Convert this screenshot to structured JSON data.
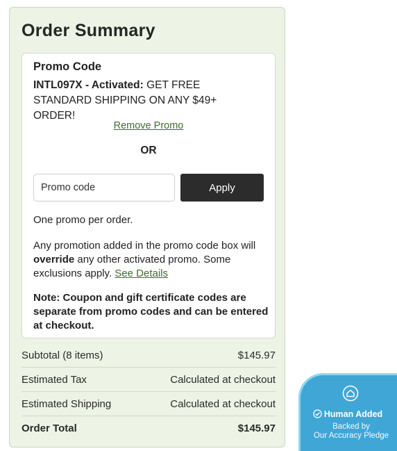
{
  "order_summary": {
    "title": "Order Summary",
    "promo": {
      "heading": "Promo Code",
      "activated_code": "INTL097X - Activated:",
      "activated_message": "GET FREE STANDARD SHIPPING ON ANY $49+ ORDER!",
      "remove_label": "Remove Promo",
      "or_label": "OR",
      "input_value": "",
      "input_placeholder": "Promo code",
      "apply_label": "Apply",
      "one_per_order": "One promo per order.",
      "override_text_1": "Any promotion added in the promo code box will",
      "override_bold": "override",
      "override_text_2": "any other activated promo. Some exclusions apply.",
      "see_details_label": "See Details",
      "coupon_note": "Note: Coupon and gift certificate codes are separate from promo codes and can be entered at checkout."
    },
    "rows": [
      {
        "label": "Subtotal (8 items)",
        "value": "$145.97"
      },
      {
        "label": "Estimated Tax",
        "value": "Calculated at checkout"
      },
      {
        "label": "Estimated Shipping",
        "value": "Calculated at checkout"
      },
      {
        "label": "Order Total",
        "value": "$145.97"
      }
    ]
  },
  "badge": {
    "title": "Human Added",
    "line1": "Backed by",
    "line2": "Our Accuracy Pledge",
    "icon": "house-check-icon"
  },
  "colors": {
    "summary_bg": "#edf3e5",
    "link_green": "#3c6e2b",
    "apply_bg": "#2c2c2c",
    "badge_bg": "#3fa6d6"
  }
}
